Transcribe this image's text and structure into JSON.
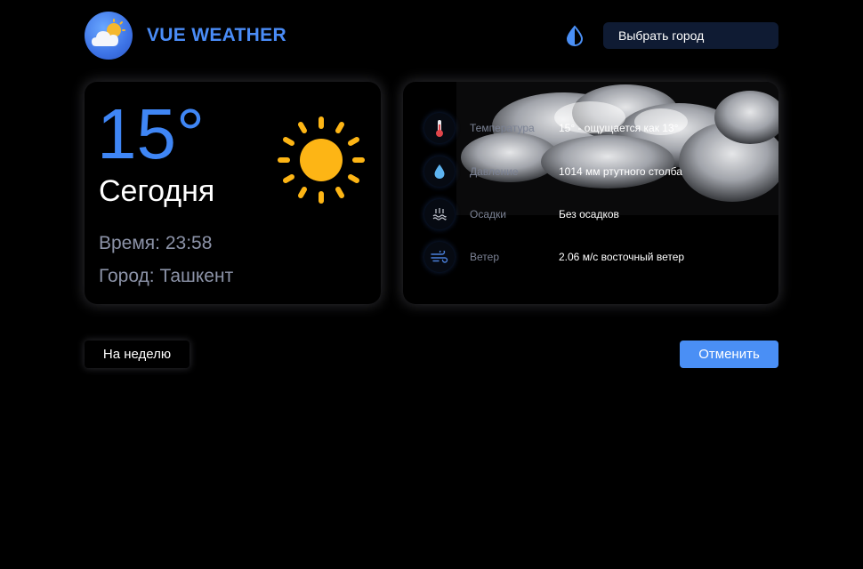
{
  "header": {
    "brand_title": "VUE WEATHER",
    "city_select_label": "Выбрать город"
  },
  "today": {
    "temperature": "15°",
    "day_label": "Сегодня",
    "time_line": "Время: 23:58",
    "city_line": "Город: Ташкент"
  },
  "details": [
    {
      "icon": "thermometer-icon",
      "label": "Температура",
      "value": "15° - ощущается как 13°"
    },
    {
      "icon": "droplet-icon",
      "label": "Давление",
      "value": "1014 мм ртутного столба"
    },
    {
      "icon": "precipitation-icon",
      "label": "Осадки",
      "value": "Без осадков"
    },
    {
      "icon": "wind-icon",
      "label": "Ветер",
      "value": "2.06 м/с восточный ветер"
    }
  ],
  "buttons": {
    "week": "На неделю",
    "cancel": "Отменить"
  },
  "colors": {
    "accent": "#4a8ff5",
    "temperature": "#3f86f5",
    "muted_text": "#8c93a8",
    "sun": "#fdb515",
    "select_bg": "#0f1b33"
  }
}
